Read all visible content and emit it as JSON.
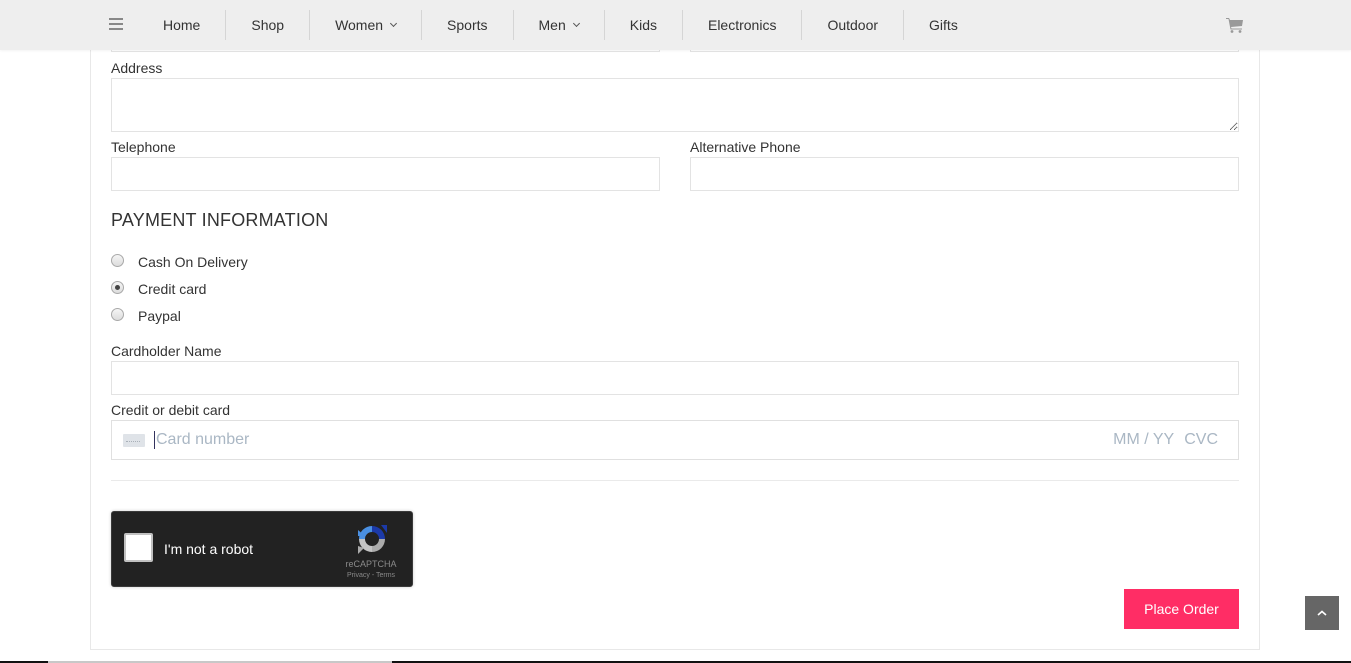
{
  "nav": {
    "menu_icon": "hamburger-icon",
    "items": [
      {
        "label": "Home",
        "has_dropdown": false
      },
      {
        "label": "Shop",
        "has_dropdown": false
      },
      {
        "label": "Women",
        "has_dropdown": true
      },
      {
        "label": "Sports",
        "has_dropdown": false
      },
      {
        "label": "Men",
        "has_dropdown": true
      },
      {
        "label": "Kids",
        "has_dropdown": false
      },
      {
        "label": "Electronics",
        "has_dropdown": false
      },
      {
        "label": "Outdoor",
        "has_dropdown": false
      },
      {
        "label": "Gifts",
        "has_dropdown": false
      }
    ],
    "cart_icon": "shopping-cart-icon"
  },
  "form": {
    "address": {
      "label": "Address",
      "value": ""
    },
    "telephone": {
      "label": "Telephone",
      "value": ""
    },
    "alt_phone": {
      "label": "Alternative Phone",
      "value": ""
    }
  },
  "payment": {
    "title": "PAYMENT INFORMATION",
    "options": [
      {
        "label": "Cash On Delivery",
        "checked": false
      },
      {
        "label": "Credit card",
        "checked": true
      },
      {
        "label": "Paypal",
        "checked": false
      }
    ],
    "cardholder": {
      "label": "Cardholder Name",
      "value": ""
    },
    "card": {
      "label": "Credit or debit card",
      "number_placeholder": "Card number",
      "expiry_placeholder": "MM / YY",
      "cvc_placeholder": "CVC"
    }
  },
  "recaptcha": {
    "text": "I'm not a robot",
    "brand": "reCAPTCHA",
    "links": "Privacy - Terms",
    "checked": false
  },
  "actions": {
    "place_order": "Place Order"
  },
  "colors": {
    "accent": "#ff2d65",
    "navbar_bg": "#eeeeee",
    "scroll_top_bg": "#666666"
  }
}
